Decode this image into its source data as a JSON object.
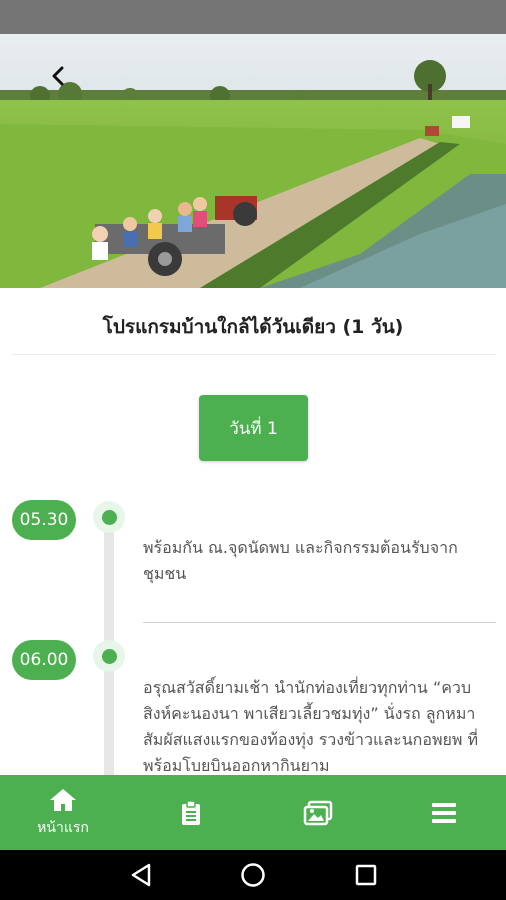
{
  "header": {
    "back_icon": "chevron-left-icon",
    "hero_image": "rice-field-tractor-tour-photo"
  },
  "program": {
    "title": "โปรแกรมบ้านใกล้ได้วันเดียว (1 วัน)",
    "day_label": "วันที่ 1"
  },
  "timeline": [
    {
      "time": "05.30",
      "text": "พร้อมกัน ณ.จุดนัดพบ และกิจกรรมต้อนรับจากชุมชน"
    },
    {
      "time": "06.00",
      "text": "อรุณสวัสดิ์ยามเช้า นำนักท่องเที่ยวทุกท่าน “ควบสิงห์คะนองนา พาเสียวเลี้ยวชมทุ่ง” นั่งรถ ลูกหมา สัมผัสแสงแรกของท้องทุ่ง รวงข้าวและนกอพยพ ที่พร้อมโบยบินออกหากินยาม"
    }
  ],
  "bottom_nav": [
    {
      "icon": "home-icon",
      "label": "หน้าแรก",
      "active": true
    },
    {
      "icon": "clipboard-icon",
      "label": ""
    },
    {
      "icon": "gallery-icon",
      "label": ""
    },
    {
      "icon": "menu-icon",
      "label": ""
    }
  ],
  "colors": {
    "accent": "#4caf50",
    "status_bar": "#757575",
    "text": "#555555"
  }
}
